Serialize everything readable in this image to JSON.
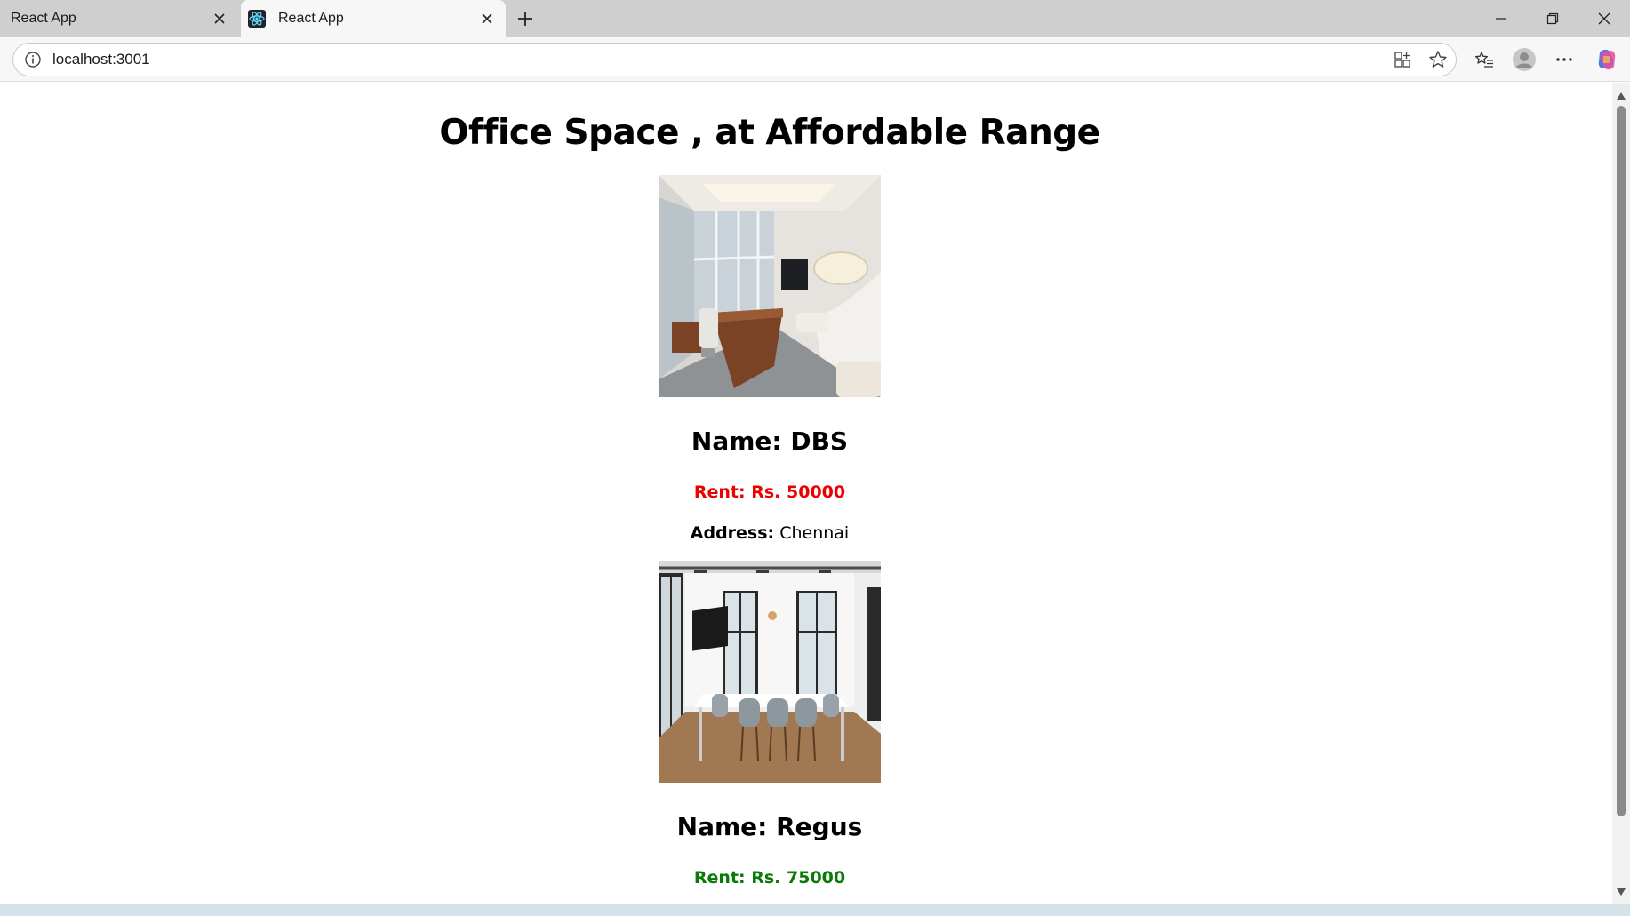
{
  "browser": {
    "tabs": [
      {
        "title": "React App",
        "active": false
      },
      {
        "title": "React App",
        "active": true
      }
    ],
    "address_bar": {
      "url": "localhost:3001"
    }
  },
  "page": {
    "title": "Office Space , at Affordable Range",
    "offices": [
      {
        "name_label": "Name: DBS",
        "rent_label": "Rent: Rs. 50000",
        "rent_color": "#ee0000",
        "address_label": "Address:",
        "address_value": "Chennai"
      },
      {
        "name_label": "Name: Regus",
        "rent_label": "Rent: Rs. 75000",
        "rent_color": "#0a7a0a"
      }
    ]
  },
  "colors": {
    "tabstrip_bg": "#cfcfcf",
    "toolbar_bg": "#f7f7f7",
    "rent_high": "#0a7a0a",
    "rent_low": "#ee0000"
  }
}
